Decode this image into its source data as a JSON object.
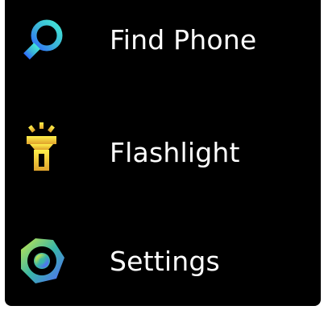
{
  "menu": {
    "items": [
      {
        "label": "Find Phone",
        "icon": "magnifying-glass-icon",
        "colors": [
          "#43e8d6",
          "#2f6bff"
        ]
      },
      {
        "label": "Flashlight",
        "icon": "flashlight-icon",
        "colors": [
          "#fff04a",
          "#e0a32c"
        ]
      },
      {
        "label": "Settings",
        "icon": "hexagon-gear-icon",
        "colors": [
          "#c9e84a",
          "#38b6a8",
          "#5566ff"
        ]
      }
    ]
  }
}
